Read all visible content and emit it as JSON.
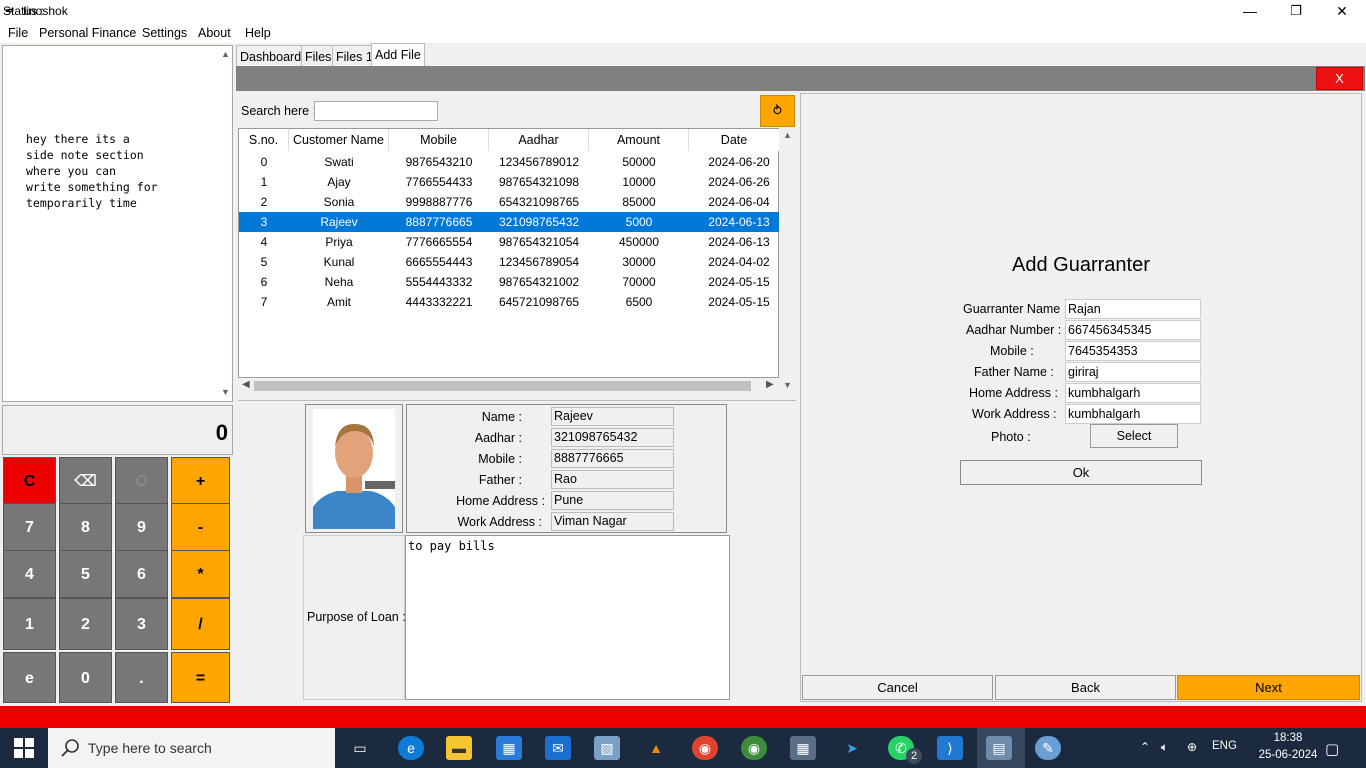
{
  "window": {
    "title": "finoshok",
    "min": "—",
    "max": "❐",
    "close": "✕"
  },
  "menu": [
    "File",
    "Personal Finance",
    "Settings",
    "About",
    "Help"
  ],
  "notes": {
    "text": "hey there its a\nside note section\nwhere you can\nwrite something for\ntemporarily time"
  },
  "calculator": {
    "display": "0",
    "keys": [
      "C",
      "⌫",
      "O",
      "+",
      "7",
      "8",
      "9",
      "-",
      "4",
      "5",
      "6",
      "*",
      "1",
      "2",
      "3",
      "/",
      "e",
      "0",
      ".",
      "="
    ]
  },
  "tabs": [
    "Dashboard",
    "Files",
    "Files 1",
    "Add File"
  ],
  "close_panel": "X",
  "search": {
    "label": "Search here :",
    "value": "",
    "refresh_icon": "⥁"
  },
  "table": {
    "columns": [
      "S.no.",
      "Customer Name",
      "Mobile",
      "Aadhar",
      "Amount",
      "Date"
    ],
    "rows": [
      [
        "0",
        "Swati",
        "9876543210",
        "123456789012",
        "50000",
        "2024-06-20"
      ],
      [
        "1",
        "Ajay",
        "7766554433",
        "987654321098",
        "10000",
        "2024-06-26"
      ],
      [
        "2",
        "Sonia",
        "9998887776",
        "654321098765",
        "85000",
        "2024-06-04"
      ],
      [
        "3",
        "Rajeev",
        "8887776665",
        "321098765432",
        "5000",
        "2024-06-13"
      ],
      [
        "4",
        "Priya",
        "7776665554",
        "987654321054",
        "450000",
        "2024-06-13"
      ],
      [
        "5",
        "Kunal",
        "6665554443",
        "123456789054",
        "30000",
        "2024-04-02"
      ],
      [
        "6",
        "Neha",
        "5554443332",
        "987654321002",
        "70000",
        "2024-05-15"
      ],
      [
        "7",
        "Amit",
        "4443332221",
        "645721098765",
        "6500",
        "2024-05-15"
      ]
    ],
    "selected_row": 3
  },
  "detail": {
    "labels": [
      "Name :",
      "Aadhar :",
      "Mobile :",
      "Father :",
      "Home Address :",
      "Work Address :"
    ],
    "values": [
      "Rajeev",
      "321098765432",
      "8887776665",
      "Rao",
      "Pune",
      "Viman Nagar"
    ],
    "purpose_label": "Purpose of Loan :",
    "purpose_text": "to pay bills"
  },
  "guarranter": {
    "title": "Add Guarranter",
    "labels": [
      "Guarranter Name :",
      "Aadhar Number :",
      "Mobile :",
      "Father Name :",
      "Home Address :",
      "Work Address :"
    ],
    "values": [
      "Rajan",
      "667456345345",
      "7645354353",
      "giriraj",
      "kumbhalgarh",
      "kumbhalgarh"
    ],
    "photo_label": "Photo :",
    "select_label": "Select",
    "ok_label": "Ok"
  },
  "nav": {
    "cancel": "Cancel",
    "back": "Back",
    "next": "Next"
  },
  "status": {
    "text": "Status :",
    "color": "#ee0000"
  },
  "accent": "#ffa500",
  "taskbar": {
    "search_placeholder": "Type here to search",
    "time": "18:38",
    "date": "25-06-2024",
    "lang": "ENG",
    "whatsapp_badge": "2"
  }
}
